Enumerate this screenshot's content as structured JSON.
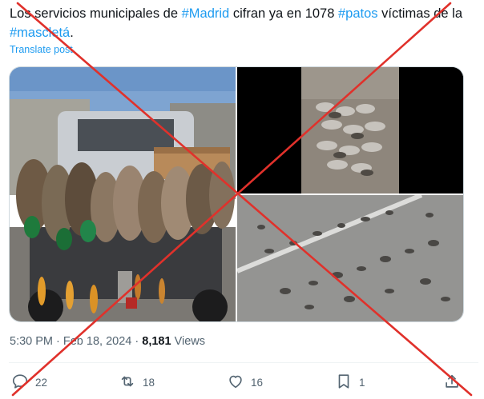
{
  "tweet": {
    "text_part1": "Los servicios municipales de ",
    "hashtag_madrid": "#Madrid",
    "text_part2": " cifran ya en 1078 ",
    "hashtag_patos": "#patos",
    "text_part3": " víctimas de la ",
    "hashtag_mascleta": "#mascletá",
    "text_part4": ".",
    "translate_label": "Translate post"
  },
  "meta": {
    "time": "5:30 PM",
    "separator": " · ",
    "date": "Feb 18, 2024",
    "separator2": " · ",
    "views_count": "8,181",
    "views_label": " Views"
  },
  "media": {
    "images": [
      {
        "name": "ducks-on-pickup-truck"
      },
      {
        "name": "dead-ducks-on-ground"
      },
      {
        "name": "ducks-on-road"
      }
    ]
  },
  "actions": {
    "reply_count": "22",
    "repost_count": "18",
    "like_count": "16",
    "bookmark_count": "1"
  },
  "overlay": {
    "color": "#e0312b",
    "meaning": "red-x-fact-check-mark"
  },
  "colors": {
    "link": "#1d9bf0",
    "text": "#0f1419",
    "secondary": "#536471"
  }
}
